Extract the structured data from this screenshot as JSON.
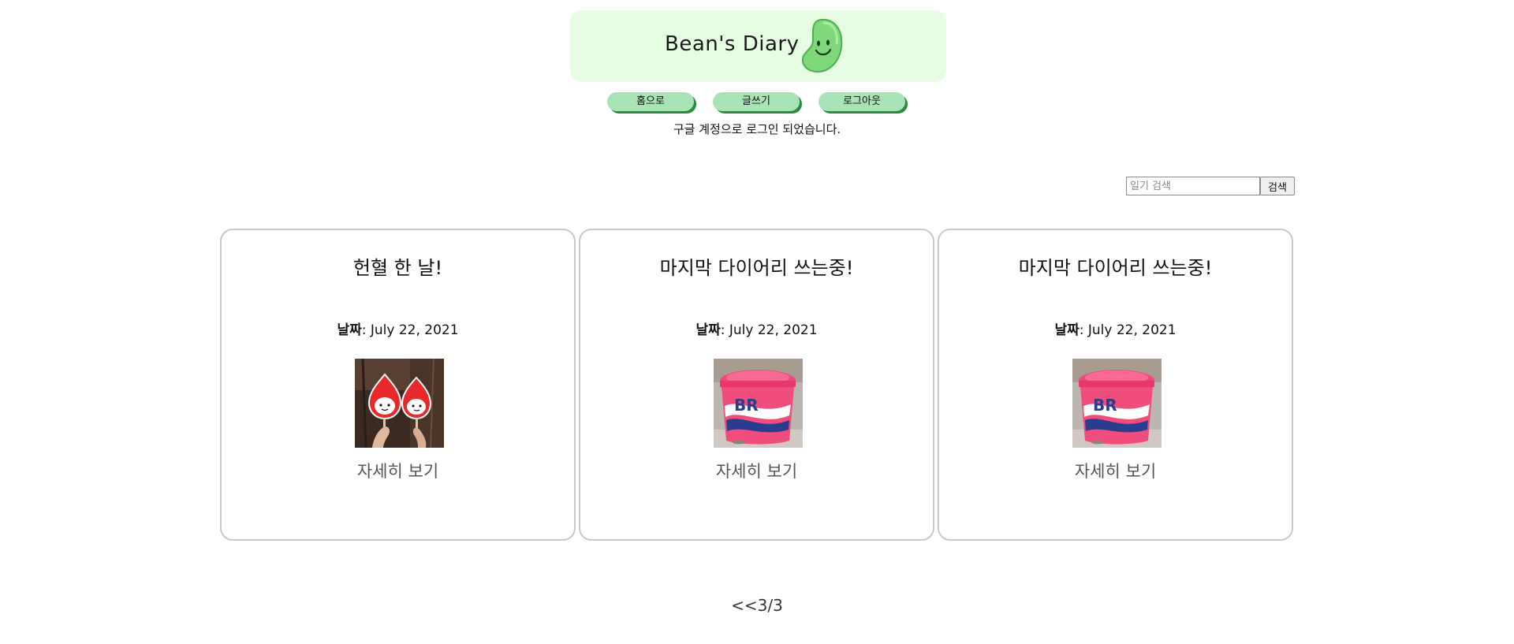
{
  "header": {
    "title": "Bean's Diary",
    "logo_icon": "bean-smiley-icon"
  },
  "nav": {
    "home_label": "홈으로",
    "write_label": "글쓰기",
    "logout_label": "로그아웃"
  },
  "status_message": "구글 계정으로 로그인 되었습니다.",
  "search": {
    "placeholder": "일기 검색",
    "value": "",
    "button_label": "검색"
  },
  "cards": [
    {
      "title": "헌혈 한 날!",
      "date_label": "날짜",
      "date_value": ": July 22, 2021",
      "image": "blood-donation-fans-photo",
      "link_label": "자세히 보기"
    },
    {
      "title": "마지막 다이어리 쓰는중!",
      "date_label": "날짜",
      "date_value": ": July 22, 2021",
      "image": "ice-cream-cup-photo",
      "link_label": "자세히 보기"
    },
    {
      "title": "마지막 다이어리 쓰는중!",
      "date_label": "날짜",
      "date_value": ": July 22, 2021",
      "image": "ice-cream-cup-photo",
      "link_label": "자세히 보기"
    }
  ],
  "pagination": {
    "prev_label": "<<",
    "page_text": "3/3"
  },
  "colors": {
    "header_bg": "#e6fde3",
    "nav_button": "#a8e3b6",
    "nav_shadow": "#2c8a3e",
    "card_border": "#c8c8c8"
  }
}
